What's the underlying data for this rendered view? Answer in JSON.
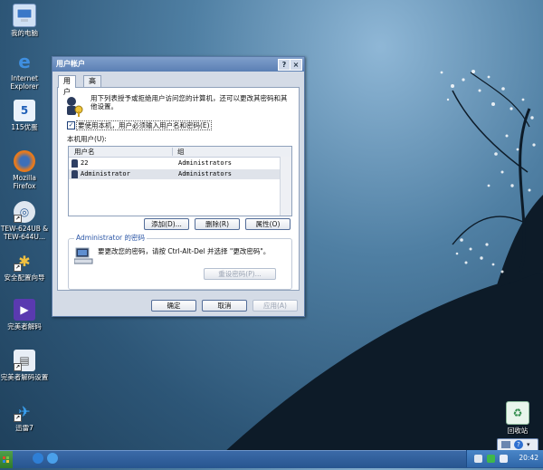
{
  "desktop": {
    "icons": [
      {
        "label": "我的电脑",
        "icon": "my-computer-icon"
      },
      {
        "label": "Internet\nExplorer",
        "icon": "internet-explorer-icon"
      },
      {
        "label": "115优蛋",
        "icon": "app-115-icon"
      },
      {
        "label": "Mozilla\nFirefox",
        "icon": "firefox-icon"
      },
      {
        "label": "TEW-624UB &\nTEW-644U...",
        "icon": "network-adapter-icon"
      },
      {
        "label": "安全配置向导",
        "icon": "security-wizard-icon"
      },
      {
        "label": "完美者解码",
        "icon": "media-player-icon"
      },
      {
        "label": "完美者解码设置",
        "icon": "media-settings-icon"
      },
      {
        "label": "迅雷7",
        "icon": "thunder-icon"
      },
      {
        "label": "回收站",
        "icon": "recycle-bin-icon"
      }
    ]
  },
  "dialog": {
    "title": "用户帐户",
    "help_button": "?",
    "close_button": "×",
    "tabs": [
      {
        "label": "用户"
      },
      {
        "label": "高级"
      }
    ],
    "description": "用下列表授予或拒绝用户访问您的计算机，还可以更改其密码和其他设置。",
    "require_login_label": "要使用本机，用户必须输入用户名和密码(E)",
    "require_login_checked": true,
    "users_label": "本机用户(U):",
    "columns": [
      "用户名",
      "组"
    ],
    "users": [
      {
        "name": "22",
        "group": "Administrators"
      },
      {
        "name": "Administrator",
        "group": "Administrators"
      }
    ],
    "add_button": "添加(D)...",
    "remove_button": "删除(R)",
    "properties_button": "属性(O)",
    "password_group_title": "Administrator 的密码",
    "password_text": "要更改您的密码，请按 Ctrl-Alt-Del 并选择 \"更改密码\"。",
    "reset_password_button": "重设密码(P)...",
    "ok_button": "确定",
    "cancel_button": "取消",
    "apply_button": "应用(A)"
  },
  "taskbar": {
    "clock": "20:42"
  }
}
